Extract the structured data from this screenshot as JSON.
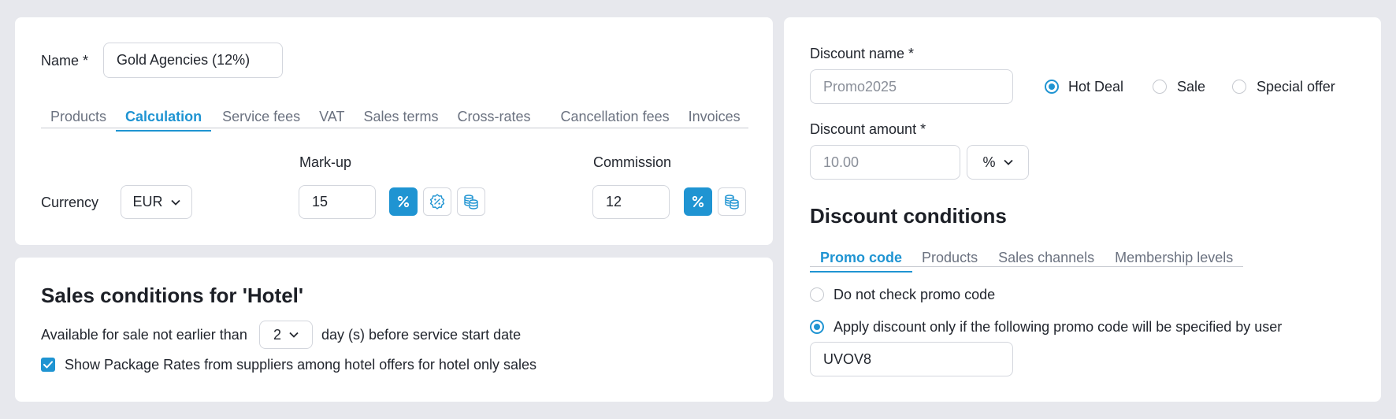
{
  "agency": {
    "name_label": "Name *",
    "name_value": "Gold Agencies (12%)",
    "tabs": [
      "Products",
      "Calculation",
      "Service fees",
      "VAT",
      "Sales terms",
      "Cross-rates",
      "Cancellation fees",
      "Invoices"
    ],
    "active_tab": "Calculation",
    "currency_label": "Currency",
    "currency_value": "EUR",
    "markup_label": "Mark-up",
    "markup_value": "15",
    "commission_label": "Commission",
    "commission_value": "12"
  },
  "sales_conditions": {
    "title": "Sales conditions for 'Hotel'",
    "available_prefix": "Available for sale not earlier than",
    "days_value": "2",
    "available_suffix": "day (s) before service start date",
    "checkbox_label": "Show Package Rates from suppliers among hotel offers for hotel only sales",
    "checkbox_checked": true
  },
  "discount": {
    "name_label": "Discount name *",
    "name_placeholder": "Promo2025",
    "types": [
      {
        "label": "Hot Deal",
        "selected": true
      },
      {
        "label": "Sale",
        "selected": false
      },
      {
        "label": "Special offer",
        "selected": false
      }
    ],
    "amount_label": "Discount amount *",
    "amount_placeholder": "10.00",
    "amount_unit": "%",
    "conditions_title": "Discount conditions",
    "condition_tabs": [
      "Promo code",
      "Products",
      "Sales channels",
      "Membership levels"
    ],
    "active_condition_tab": "Promo code",
    "promo_options": [
      {
        "label": "Do not check promo code",
        "selected": false
      },
      {
        "label": "Apply discount only if the following promo code will be specified by user",
        "selected": true
      }
    ],
    "promo_code_value": "UVOV8"
  },
  "colors": {
    "accent": "#1f94d2",
    "background": "#e7e8ed",
    "card": "#ffffff"
  }
}
